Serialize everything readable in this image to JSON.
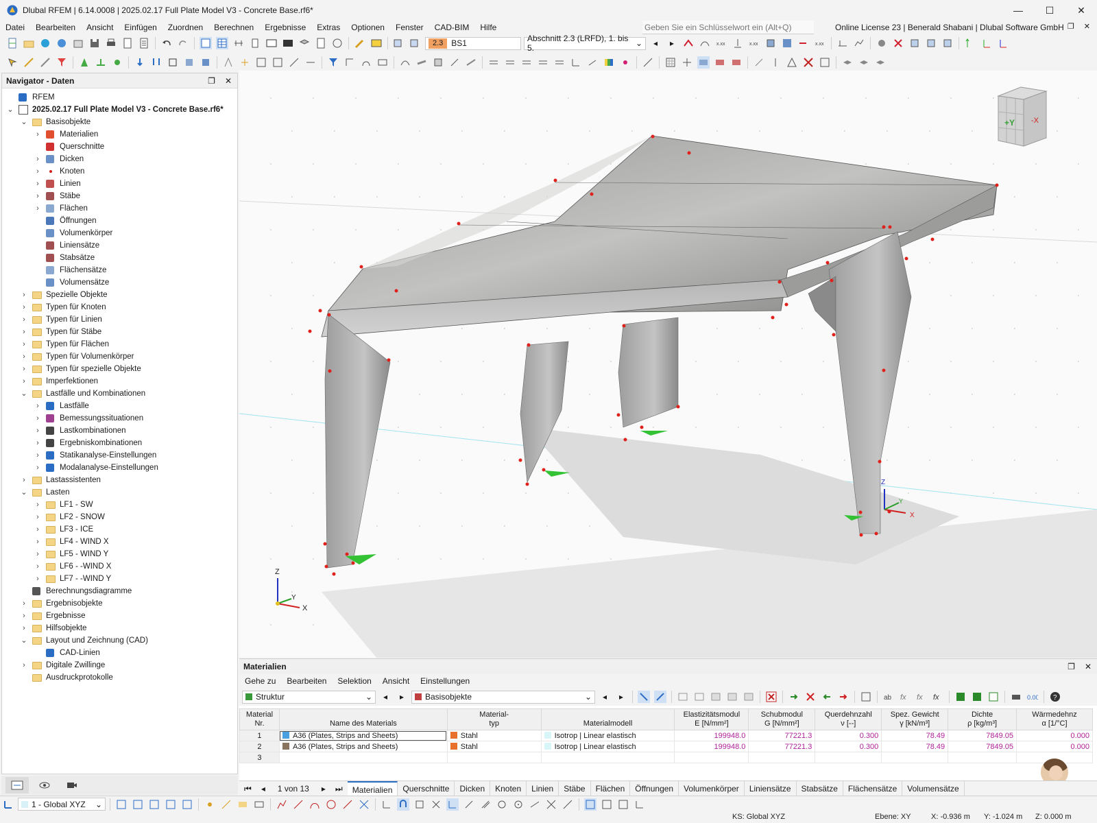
{
  "window": {
    "title": "Dlubal RFEM | 6.14.0008 | 2025.02.17 Full Plate Model V3 - Concrete Base.rf6*",
    "minimize": "—",
    "maximize": "☐",
    "close": "✕"
  },
  "menu": {
    "items": [
      "Datei",
      "Bearbeiten",
      "Ansicht",
      "Einfügen",
      "Zuordnen",
      "Berechnen",
      "Ergebnisse",
      "Extras",
      "Optionen",
      "Fenster",
      "CAD-BIM",
      "Hilfe"
    ],
    "search_placeholder": "Geben Sie ein Schlüsselwort ein (Alt+Q)",
    "license": "Online License 23 | Benerald Shabani | Dlubal Software GmbH"
  },
  "toolbar": {
    "loadcase_num": "2.3",
    "loadcase_name": "BS1",
    "section": "Abschnitt 2.3 (LRFD), 1. bis 5."
  },
  "navigator": {
    "title": "Navigator - Daten",
    "items": [
      {
        "label": "RFEM",
        "level": 0,
        "chev": "",
        "icon": "rfem-icon"
      },
      {
        "label": "2025.02.17 Full Plate Model V3 - Concrete Base.rf6*",
        "level": 0,
        "chev": "v",
        "icon": "model-file-icon",
        "bold": true
      },
      {
        "label": "Basisobjekte",
        "level": 1,
        "chev": "v",
        "icon": "folder-icon"
      },
      {
        "label": "Materialien",
        "level": 2,
        "chev": ">",
        "icon": "materials-icon"
      },
      {
        "label": "Querschnitte",
        "level": 2,
        "chev": "",
        "icon": "sections-icon"
      },
      {
        "label": "Dicken",
        "level": 2,
        "chev": ">",
        "icon": "thickness-icon"
      },
      {
        "label": "Knoten",
        "level": 2,
        "chev": ">",
        "icon": "node-icon"
      },
      {
        "label": "Linien",
        "level": 2,
        "chev": ">",
        "icon": "line-icon"
      },
      {
        "label": "Stäbe",
        "level": 2,
        "chev": ">",
        "icon": "member-icon"
      },
      {
        "label": "Flächen",
        "level": 2,
        "chev": ">",
        "icon": "surface-icon"
      },
      {
        "label": "Öffnungen",
        "level": 2,
        "chev": "",
        "icon": "opening-icon"
      },
      {
        "label": "Volumenkörper",
        "level": 2,
        "chev": "",
        "icon": "solid-icon"
      },
      {
        "label": "Liniensätze",
        "level": 2,
        "chev": "",
        "icon": "lineset-icon"
      },
      {
        "label": "Stabsätze",
        "level": 2,
        "chev": "",
        "icon": "memberset-icon"
      },
      {
        "label": "Flächensätze",
        "level": 2,
        "chev": "",
        "icon": "surfaceset-icon"
      },
      {
        "label": "Volumensätze",
        "level": 2,
        "chev": "",
        "icon": "solidset-icon"
      },
      {
        "label": "Spezielle Objekte",
        "level": 1,
        "chev": ">",
        "icon": "folder-icon"
      },
      {
        "label": "Typen für Knoten",
        "level": 1,
        "chev": ">",
        "icon": "folder-icon"
      },
      {
        "label": "Typen für Linien",
        "level": 1,
        "chev": ">",
        "icon": "folder-icon"
      },
      {
        "label": "Typen für Stäbe",
        "level": 1,
        "chev": ">",
        "icon": "folder-icon"
      },
      {
        "label": "Typen für Flächen",
        "level": 1,
        "chev": ">",
        "icon": "folder-icon"
      },
      {
        "label": "Typen für Volumenkörper",
        "level": 1,
        "chev": ">",
        "icon": "folder-icon"
      },
      {
        "label": "Typen für spezielle Objekte",
        "level": 1,
        "chev": ">",
        "icon": "folder-icon"
      },
      {
        "label": "Imperfektionen",
        "level": 1,
        "chev": ">",
        "icon": "folder-icon"
      },
      {
        "label": "Lastfälle und Kombinationen",
        "level": 1,
        "chev": "v",
        "icon": "folder-icon"
      },
      {
        "label": "Lastfälle",
        "level": 2,
        "chev": ">",
        "icon": "loadcase-icon"
      },
      {
        "label": "Bemessungssituationen",
        "level": 2,
        "chev": ">",
        "icon": "design-situation-icon"
      },
      {
        "label": "Lastkombinationen",
        "level": 2,
        "chev": ">",
        "icon": "load-combination-icon"
      },
      {
        "label": "Ergebniskombinationen",
        "level": 2,
        "chev": ">",
        "icon": "result-combination-icon"
      },
      {
        "label": "Statikanalyse-Einstellungen",
        "level": 2,
        "chev": ">",
        "icon": "static-settings-icon"
      },
      {
        "label": "Modalanalyse-Einstellungen",
        "level": 2,
        "chev": ">",
        "icon": "modal-settings-icon"
      },
      {
        "label": "Lastassistenten",
        "level": 1,
        "chev": ">",
        "icon": "folder-icon"
      },
      {
        "label": "Lasten",
        "level": 1,
        "chev": "v",
        "icon": "folder-icon"
      },
      {
        "label": "LF1 - SW",
        "level": 2,
        "chev": ">",
        "icon": "folder-icon"
      },
      {
        "label": "LF2 - SNOW",
        "level": 2,
        "chev": ">",
        "icon": "folder-icon"
      },
      {
        "label": "LF3 - ICE",
        "level": 2,
        "chev": ">",
        "icon": "folder-icon"
      },
      {
        "label": "LF4 - WIND X",
        "level": 2,
        "chev": ">",
        "icon": "folder-icon"
      },
      {
        "label": "LF5 - WIND Y",
        "level": 2,
        "chev": ">",
        "icon": "folder-icon"
      },
      {
        "label": "LF6 - -WIND X",
        "level": 2,
        "chev": ">",
        "icon": "folder-icon"
      },
      {
        "label": "LF7 - -WIND Y",
        "level": 2,
        "chev": ">",
        "icon": "folder-icon"
      },
      {
        "label": "Berechnungsdiagramme",
        "level": 1,
        "chev": "",
        "icon": "diagram-icon"
      },
      {
        "label": "Ergebnisobjekte",
        "level": 1,
        "chev": ">",
        "icon": "folder-icon"
      },
      {
        "label": "Ergebnisse",
        "level": 1,
        "chev": ">",
        "icon": "folder-icon"
      },
      {
        "label": "Hilfsobjekte",
        "level": 1,
        "chev": ">",
        "icon": "folder-icon"
      },
      {
        "label": "Layout und Zeichnung (CAD)",
        "level": 1,
        "chev": "v",
        "icon": "folder-icon"
      },
      {
        "label": "CAD-Linien",
        "level": 2,
        "chev": "",
        "icon": "cad-line-icon"
      },
      {
        "label": "Digitale Zwillinge",
        "level": 1,
        "chev": ">",
        "icon": "folder-icon"
      },
      {
        "label": "Ausdruckprotokolle",
        "level": 1,
        "chev": "",
        "icon": "folder-icon"
      }
    ]
  },
  "viewport": {
    "axes_labels": {
      "z": "Z",
      "y": "Y",
      "x": "X"
    },
    "viewcube": {
      "front": "+Y",
      "side": "-X"
    }
  },
  "materials": {
    "title": "Materialien",
    "menu": [
      "Gehe zu",
      "Bearbeiten",
      "Selektion",
      "Ansicht",
      "Einstellungen"
    ],
    "filter1": "Struktur",
    "filter2": "Basisobjekte",
    "headers": {
      "nr": [
        "Material",
        "Nr."
      ],
      "name": "Name des Materials",
      "type": [
        "Material-",
        "typ"
      ],
      "model": "Materialmodell",
      "e": [
        "Elastizitätsmodul",
        "E [N/mm²]"
      ],
      "g": [
        "Schubmodul",
        "G [N/mm²]"
      ],
      "nu": [
        "Querdehnzahl",
        "ν [--]"
      ],
      "gamma": [
        "Spez. Gewicht",
        "γ [kN/m³]"
      ],
      "rho": [
        "Dichte",
        "ρ [kg/m³]"
      ],
      "alpha": [
        "Wärmedehnz",
        "α [1/°C]"
      ]
    },
    "rows": [
      {
        "nr": "1",
        "name": "A36 (Plates, Strips and Sheets)",
        "color": "#4a9fe0",
        "type": "Stahl",
        "model": "Isotrop | Linear elastisch",
        "e": "199948.0",
        "g": "77221.3",
        "nu": "0.300",
        "gamma": "78.49",
        "rho": "7849.05",
        "alpha": "0.000"
      },
      {
        "nr": "2",
        "name": "A36 (Plates, Strips and Sheets)",
        "color": "#8a7560",
        "type": "Stahl",
        "model": "Isotrop | Linear elastisch",
        "e": "199948.0",
        "g": "77221.3",
        "nu": "0.300",
        "gamma": "78.49",
        "rho": "7849.05",
        "alpha": "0.000"
      },
      {
        "nr": "3",
        "name": "",
        "color": "",
        "type": "",
        "model": "",
        "e": "",
        "g": "",
        "nu": "",
        "gamma": "",
        "rho": "",
        "alpha": ""
      }
    ],
    "pager_text": "1 von 13",
    "tabs": [
      "Materialien",
      "Querschnitte",
      "Dicken",
      "Knoten",
      "Linien",
      "Stäbe",
      "Flächen",
      "Öffnungen",
      "Volumenkörper",
      "Liniensätze",
      "Stabsätze",
      "Flächensätze",
      "Volumensätze"
    ],
    "active_tab": "Materialien"
  },
  "status": {
    "coord_system": "1 - Global XYZ",
    "ks": "KS: Global XYZ",
    "plane": "Ebene: XY",
    "x": "X: -0.936 m",
    "y": "Y: -1.024 m",
    "z": "Z: 0.000 m"
  },
  "colors": {
    "accent": "#2b6cc4",
    "node": "#e0201a",
    "support": "#33c233",
    "value": "#b0209a"
  }
}
